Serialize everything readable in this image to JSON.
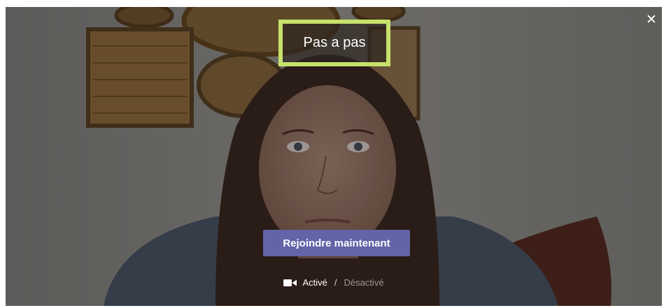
{
  "dialog": {
    "title": "Pas a pas",
    "close_icon": "close-icon",
    "join_label": "Rejoindre maintenant",
    "video": {
      "icon": "video-camera-icon",
      "on_label": "Activé",
      "separator": "/",
      "off_label": "Désactivé",
      "selected": "on"
    }
  },
  "colors": {
    "join_button": "#6264a7",
    "title_highlight": "#c7e26c"
  }
}
